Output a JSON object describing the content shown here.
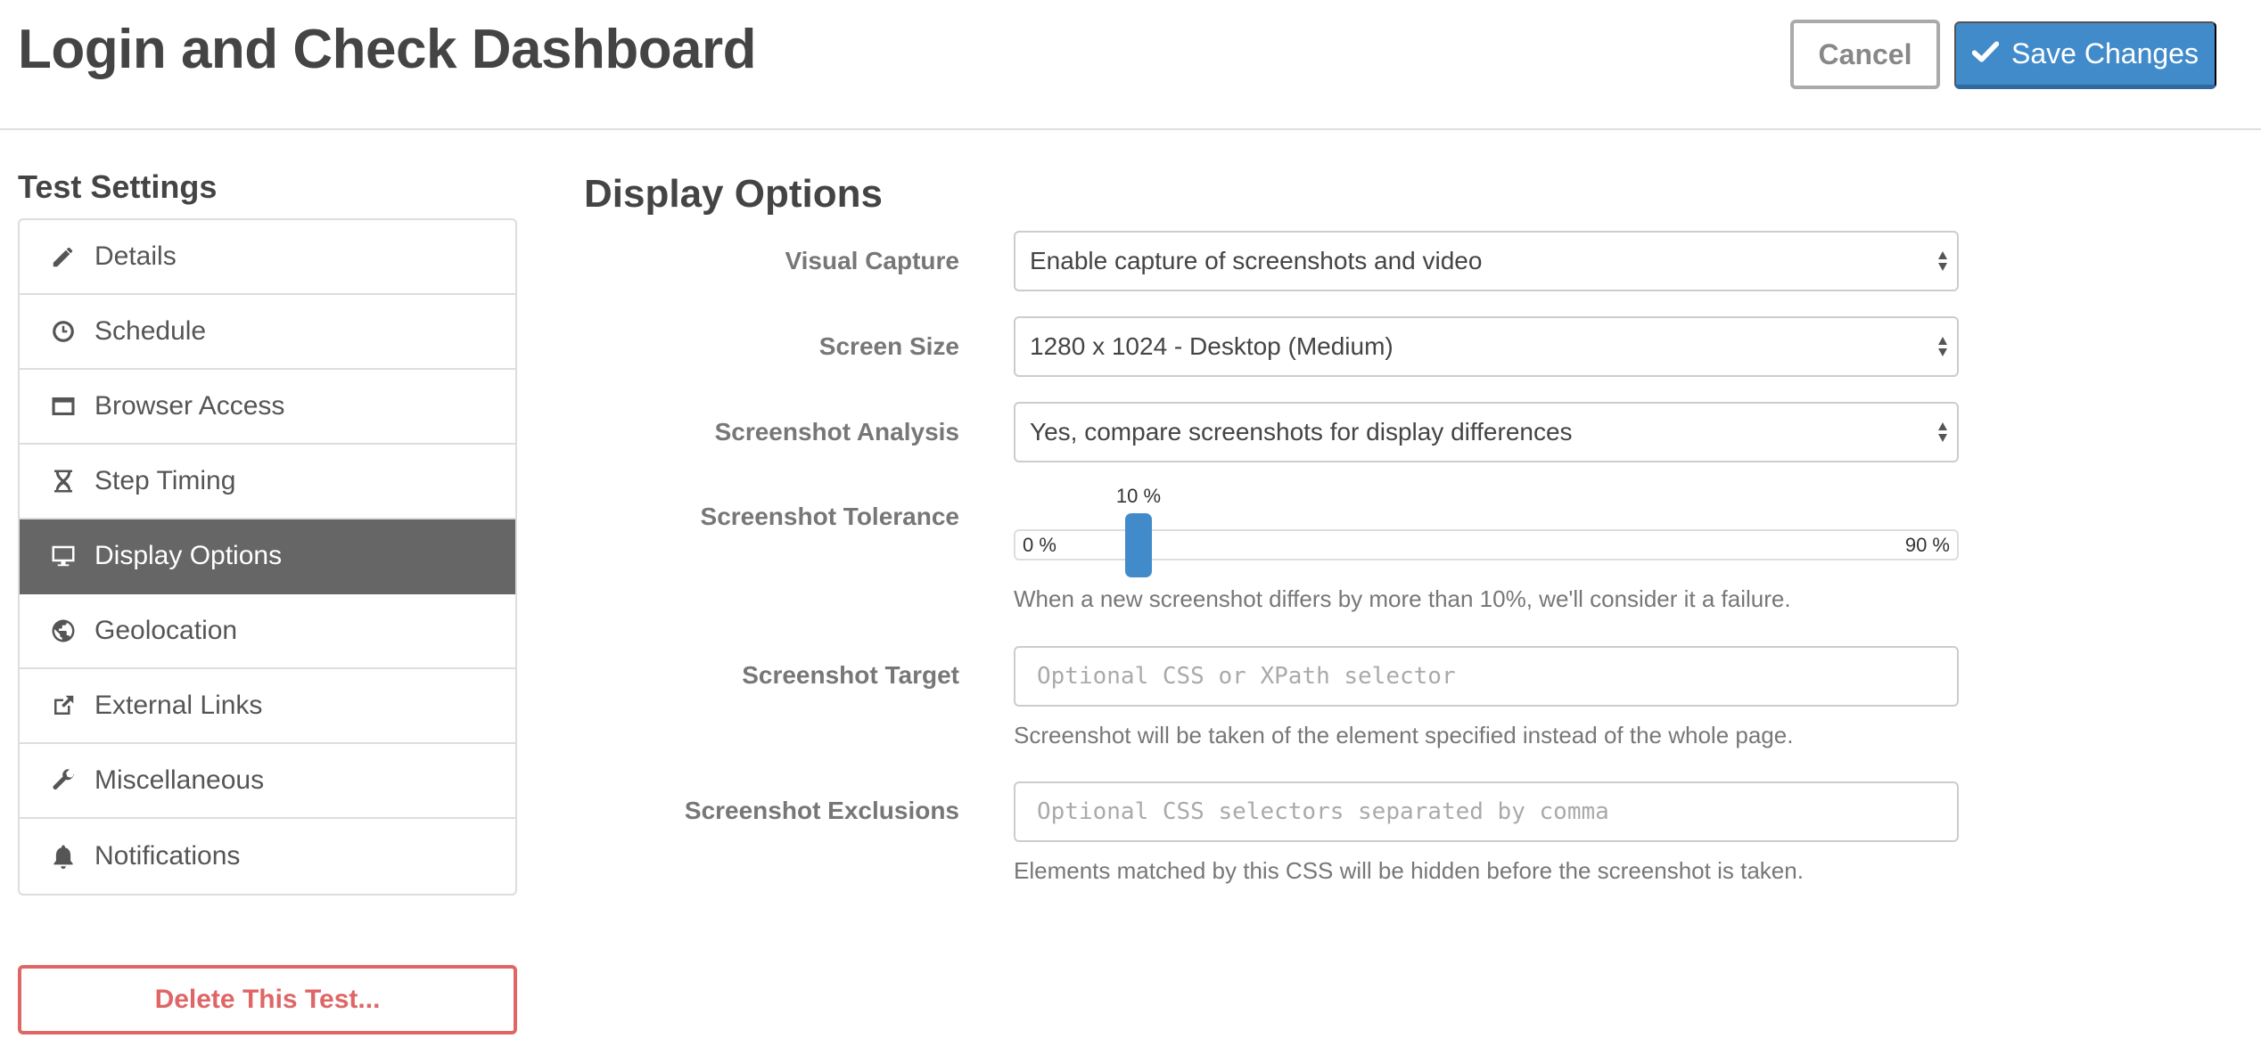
{
  "header": {
    "title": "Login and Check Dashboard",
    "cancel_label": "Cancel",
    "save_label": "Save Changes",
    "save_icon": "checkmark-icon"
  },
  "sidebar": {
    "title": "Test Settings",
    "items": [
      {
        "label": "Details",
        "icon": "pencil-icon",
        "active": false
      },
      {
        "label": "Schedule",
        "icon": "clock-icon",
        "active": false
      },
      {
        "label": "Browser Access",
        "icon": "browser-window-icon",
        "active": false
      },
      {
        "label": "Step Timing",
        "icon": "hourglass-icon",
        "active": false
      },
      {
        "label": "Display Options",
        "icon": "monitor-icon",
        "active": true
      },
      {
        "label": "Geolocation",
        "icon": "globe-icon",
        "active": false
      },
      {
        "label": "External Links",
        "icon": "external-link-icon",
        "active": false
      },
      {
        "label": "Miscellaneous",
        "icon": "wrench-icon",
        "active": false
      },
      {
        "label": "Notifications",
        "icon": "bell-icon",
        "active": false
      }
    ],
    "delete_label": "Delete This Test..."
  },
  "main": {
    "section_title": "Display Options",
    "visual_capture": {
      "label": "Visual Capture",
      "value": "Enable capture of screenshots and video"
    },
    "screen_size": {
      "label": "Screen Size",
      "value": "1280 x 1024 - Desktop (Medium)"
    },
    "screenshot_analysis": {
      "label": "Screenshot Analysis",
      "value": "Yes, compare screenshots for display differences"
    },
    "screenshot_tolerance": {
      "label": "Screenshot Tolerance",
      "value": 10,
      "min": 0,
      "max": 90,
      "value_label": "10 %",
      "min_label": "0 %",
      "max_label": "90 %",
      "help": "When a new screenshot differs by more than 10%, we'll consider it a failure."
    },
    "screenshot_target": {
      "label": "Screenshot Target",
      "value": "",
      "placeholder": "Optional CSS or XPath selector",
      "help": "Screenshot will be taken of the element specified instead of the whole page."
    },
    "screenshot_exclusions": {
      "label": "Screenshot Exclusions",
      "value": "",
      "placeholder": "Optional CSS selectors separated by comma",
      "help": "Elements matched by this CSS will be hidden before the screenshot is taken."
    }
  },
  "colors": {
    "primary": "#428bca",
    "danger": "#e06666",
    "active_nav": "#666666"
  }
}
